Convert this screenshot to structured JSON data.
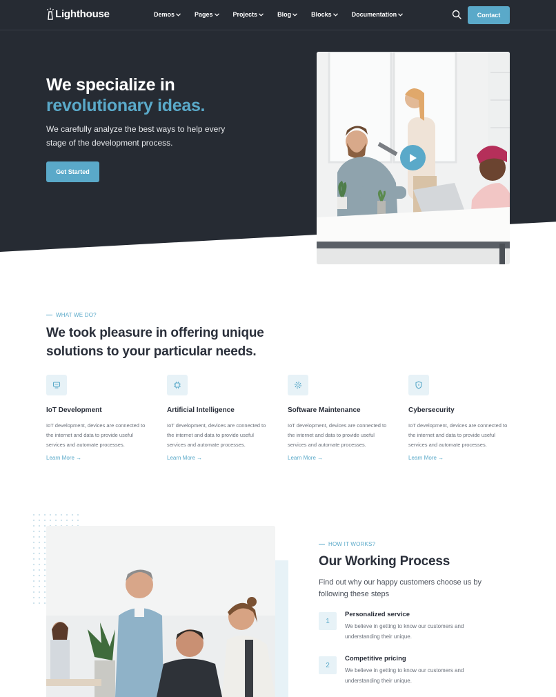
{
  "brand": {
    "name": "Lighthouse",
    "accent": "#5aa9c9",
    "dark": "#262b33"
  },
  "nav": {
    "items": [
      {
        "label": "Demos"
      },
      {
        "label": "Pages"
      },
      {
        "label": "Projects"
      },
      {
        "label": "Blog"
      },
      {
        "label": "Blocks"
      },
      {
        "label": "Documentation"
      }
    ],
    "search_icon": "search-icon",
    "contact_label": "Contact"
  },
  "hero": {
    "title_line1": "We specialize in",
    "title_line2": "revolutionary ideas.",
    "text": "We carefully analyze the best ways to help every stage of the development process.",
    "cta_label": "Get Started",
    "play_icon": "play-icon"
  },
  "services": {
    "eyebrow": "WHAT WE DO?",
    "title": "We took pleasure in offering unique solutions to your particular needs.",
    "items": [
      {
        "icon": "monitor-icon",
        "title": "IoT Development",
        "desc": "IoT development, devices are connected to the internet and data to provide useful services and automate processes.",
        "link": "Learn More →"
      },
      {
        "icon": "chip-icon",
        "title": "Artificial Intelligence",
        "desc": "IoT development, devices are connected to the internet and data to provide useful services and automate processes.",
        "link": "Learn More →"
      },
      {
        "icon": "gear-icon",
        "title": "Software Maintenance",
        "desc": "IoT development, devices are connected to the internet and data to provide useful services and automate processes.",
        "link": "Learn More →"
      },
      {
        "icon": "shield-icon",
        "title": "Cybersecurity",
        "desc": "IoT development, devices are connected to the internet and data to provide useful services and automate processes.",
        "link": "Learn More →"
      }
    ]
  },
  "process": {
    "eyebrow": "HOW IT WORKS?",
    "title": "Our Working Process",
    "intro": "Find out why our happy customers choose us by following these steps",
    "steps": [
      {
        "num": "1",
        "title": "Personalized service",
        "desc": "We believe in getting to know our customers and understanding their unique."
      },
      {
        "num": "2",
        "title": "Competitive pricing",
        "desc": "We believe in getting to know our customers and understanding their unique."
      }
    ]
  }
}
